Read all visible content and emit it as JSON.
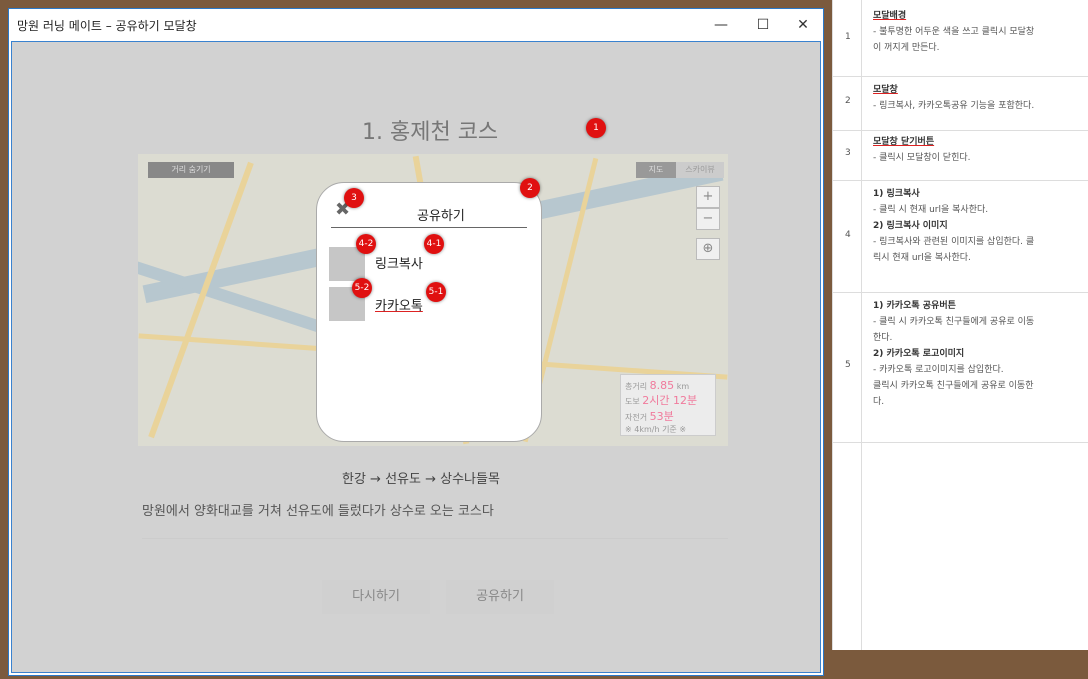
{
  "window": {
    "title": "망원 러닝 메이트 – 공유하기 모달창",
    "controls": {
      "minimize": "—",
      "maximize": "☐",
      "close": "✕"
    }
  },
  "page": {
    "course_title": "1. 홍제천 코스",
    "route": "한강 → 선유도 → 상수나들목",
    "description": "망원에서 양화대교를 거쳐 선유도에 들렀다가 상수로 오는 코스다",
    "retry_button": "다시하기",
    "share_button": "공유하기"
  },
  "map": {
    "hide_distance": "거리 숨기기",
    "map_type": "지도",
    "satellite_type": "스카이뷰",
    "zoom_in": "+",
    "zoom_out": "−",
    "locate": "⊕",
    "stats": {
      "total_label": "총거리",
      "total_value": "8.85",
      "total_unit": "km",
      "walk_label": "도보",
      "walk_value": "2시간 12분",
      "bike_label": "자전거",
      "bike_value": "53분",
      "note": "※ 4km/h 기준 ※"
    }
  },
  "modal": {
    "title": "공유하기",
    "close_icon": "✖",
    "link_copy": "링크복사",
    "kakao_share": "카카오톡"
  },
  "badges": {
    "b1": "1",
    "b2": "2",
    "b3": "3",
    "b41": "4-1",
    "b42": "4-2",
    "b51": "5-1",
    "b52": "5-2"
  },
  "panel": {
    "rows": [
      {
        "num": "1",
        "title": "모달배경",
        "lines": [
          "- 불투명한 어두운 색을 쓰고 클릭시 모달창",
          "이 꺼지게 만든다."
        ]
      },
      {
        "num": "2",
        "title": "모달창",
        "lines": [
          "- 링크복사, 카카오톡공유 기능을 포함한다."
        ]
      },
      {
        "num": "3",
        "title": "모달창 닫기버튼",
        "lines": [
          "- 클릭시 모달창이 닫힌다."
        ]
      },
      {
        "num": "4",
        "t1": "1) 링크복사",
        "l1": "- 클릭 시 현재 url을 복사한다.",
        "t2": "2) 링크복사 이미지",
        "l2a": "- 링크복사와 관련된 이미지를 삽입한다. 클",
        "l2b": "릭시 현재 url을 복사한다."
      },
      {
        "num": "5",
        "t1": "1) 카카오톡 공유버튼",
        "l1a": "- 클릭 시 카카오톡 친구들에게 공유로 이동",
        "l1b": "한다.",
        "t2": "2) 카카오톡 로고이미지",
        "l2a": "- 카카오톡 로고이미지를 삽입한다.",
        "l2b": "클릭시 카카오톡 친구들에게 공유로 이동한",
        "l2c": "다."
      }
    ]
  },
  "colors": {
    "badge": "#e01010",
    "window_border": "#2a78c8",
    "stat_accent": "#f07a9c",
    "desktop": "#7b5a3d"
  }
}
